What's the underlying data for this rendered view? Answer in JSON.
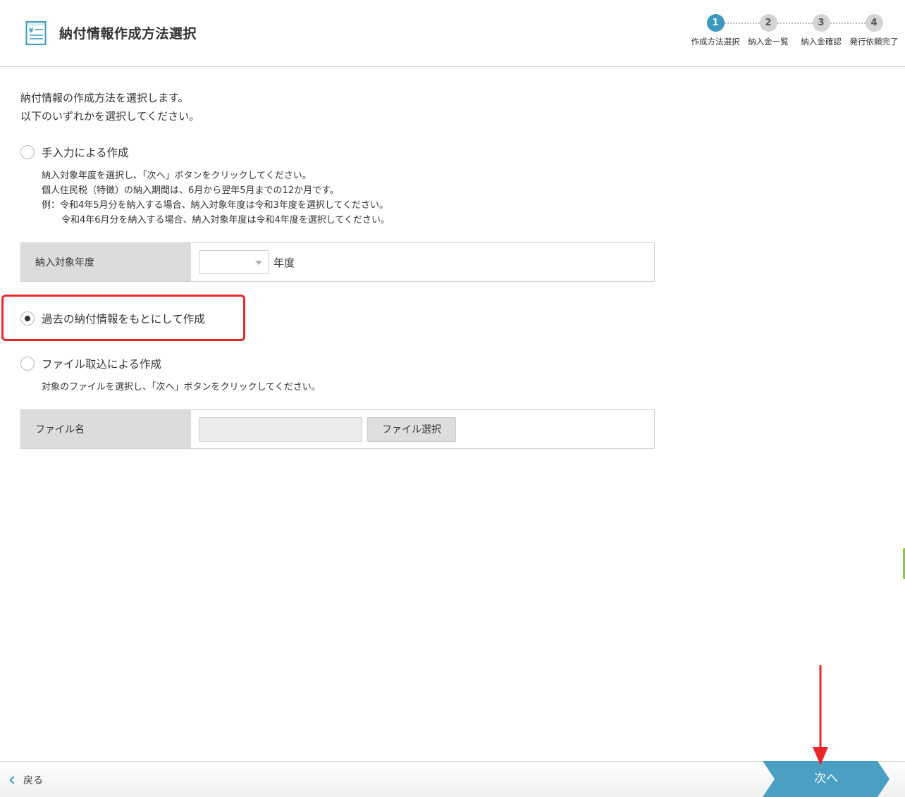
{
  "header": {
    "title": "納付情報作成方法選択",
    "icon": "invoice-yen-icon"
  },
  "stepper": {
    "steps": [
      {
        "number": "1",
        "label": "作成方法選択",
        "active": true
      },
      {
        "number": "2",
        "label": "納入金一覧",
        "active": false
      },
      {
        "number": "3",
        "label": "納入金確認",
        "active": false
      },
      {
        "number": "4",
        "label": "発行依頼完了",
        "active": false
      }
    ],
    "active_color": "#3d98bd"
  },
  "intro": {
    "line1": "納付情報の作成方法を選択します。",
    "line2": "以下のいずれかを選択してください。"
  },
  "options": {
    "manual": {
      "label": "手入力による作成",
      "checked": false,
      "desc": [
        "納入対象年度を選択し、「次へ」ボタンをクリックしてください。",
        "個人住民税（特徴）の納入期間は、6月から翌年5月までの12か月です。",
        "例：令和4年5月分を納入する場合、納入対象年度は令和3年度を選択してください。",
        "令和4年6月分を納入する場合、納入対象年度は令和4年度を選択してください。"
      ],
      "field_label": "納入対象年度",
      "select_value": "",
      "suffix": "年度"
    },
    "past": {
      "label": "過去の納付情報をもとにして作成",
      "checked": true
    },
    "file": {
      "label": "ファイル取込による作成",
      "checked": false,
      "desc": "対象のファイルを選択し、「次へ」ボタンをクリックしてください。",
      "field_label": "ファイル名",
      "file_value": "",
      "button_label": "ファイル選択"
    }
  },
  "footer": {
    "back_label": "戻る",
    "next_label": "次へ",
    "next_color": "#4a9fc3"
  },
  "annotation": {
    "highlight_color": "#e8262c"
  }
}
